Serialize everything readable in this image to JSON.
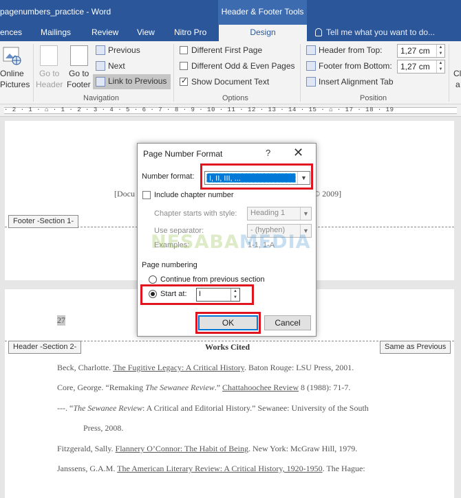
{
  "window": {
    "title": "pagenumbers_practice - Word",
    "context_tab_group": "Header & Footer Tools"
  },
  "tabs": [
    {
      "label": "ences"
    },
    {
      "label": "Mailings"
    },
    {
      "label": "Review"
    },
    {
      "label": "View"
    },
    {
      "label": "Nitro Pro"
    },
    {
      "label": "Design"
    }
  ],
  "tell_me": "Tell me what you want to do...",
  "ribbon": {
    "online_pictures": [
      "Online",
      "Pictures"
    ],
    "go_to_header": [
      "Go to",
      "Header"
    ],
    "go_to_footer": [
      "Go to",
      "Footer"
    ],
    "previous": "Previous",
    "next": "Next",
    "link_to_previous": "Link to Previous",
    "navigation_label": "Navigation",
    "different_first_page": "Different First Page",
    "different_odd_even": "Different Odd & Even Pages",
    "show_document_text": "Show Document Text",
    "options_label": "Options",
    "header_from_top": "Header from Top:",
    "header_from_top_value": "1,27 cm",
    "footer_from_bottom": "Footer from Bottom:",
    "footer_from_bottom_value": "1,27 cm",
    "insert_alignment_tab": "Insert Alignment Tab",
    "position_label": "Position",
    "cut_off": [
      "Cl",
      "a"
    ]
  },
  "ruler": {
    "text": "· 2 · 1 · ⌂ · 1 · 2 · 3 · 4 · 5 · 6 · 7 · 8 · 9 · 10 · 11 · 12 · 13 · 14 · 15 · ⌂ · 17 · 18 · 19"
  },
  "document": {
    "footer_text_left": "[Docu",
    "footer_text_right": "© 2009]",
    "footer_tag": "Footer -Section 1-",
    "page_number": "27",
    "header_tag": "Header -Section 2-",
    "same_as_previous": "Same as Previous",
    "heading": "Works Cited",
    "citations": [
      {
        "pre": "Beck, Charlotte.  ",
        "u": "The Fugitive Legacy: A Critical History",
        "post": ".  Baton Rouge: LSU Press, 2001."
      },
      {
        "pre": "Core, George.  “Remaking ",
        "i": "The Sewanee Review",
        "mid": ".” ",
        "u": "Chattahoochee Review",
        "post": " 8 (1988): 71-7."
      },
      {
        "pre": "---. “",
        "i": "The Sewanee Review",
        "post": ": A Critical and Editorial History.” Sewanee: University of the South"
      },
      {
        "pre": "Press, 2008."
      },
      {
        "pre": "Fitzgerald, Sally. ",
        "u": "Flannery O’Connor: The Habit of Being",
        "post": ".  New York: McGraw Hill, 1979."
      },
      {
        "pre": "Janssens, G.A.M. ",
        "u": "The American Literary Review: A Critical History, 1920-1950",
        "post": ". The Hague:"
      }
    ]
  },
  "dialog": {
    "title": "Page Number Format",
    "help": "?",
    "close": "✕",
    "number_format_label": "Number format:",
    "number_format_value": "I, II, III, ...",
    "include_chapter_number": "Include chapter number",
    "chapter_starts_label": "Chapter starts with style:",
    "chapter_starts_value": "Heading 1",
    "use_separator_label": "Use separator:",
    "use_separator_value": "-   (hyphen)",
    "examples_label": "Examples:",
    "examples_value": "1-1, 1-A",
    "page_numbering_label": "Page numbering",
    "continue_label": "Continue from previous section",
    "start_at_label": "Start at:",
    "start_at_value": "I",
    "ok": "OK",
    "cancel": "Cancel"
  },
  "watermark": {
    "part1": "NESABA",
    "part2": "MEDIA",
    "color1": "#8dbb3a",
    "color2": "#3a8fd0"
  },
  "colors": {
    "title_bar": "#2b579a",
    "highlight": "#e0141e",
    "selection": "#0078d7"
  }
}
